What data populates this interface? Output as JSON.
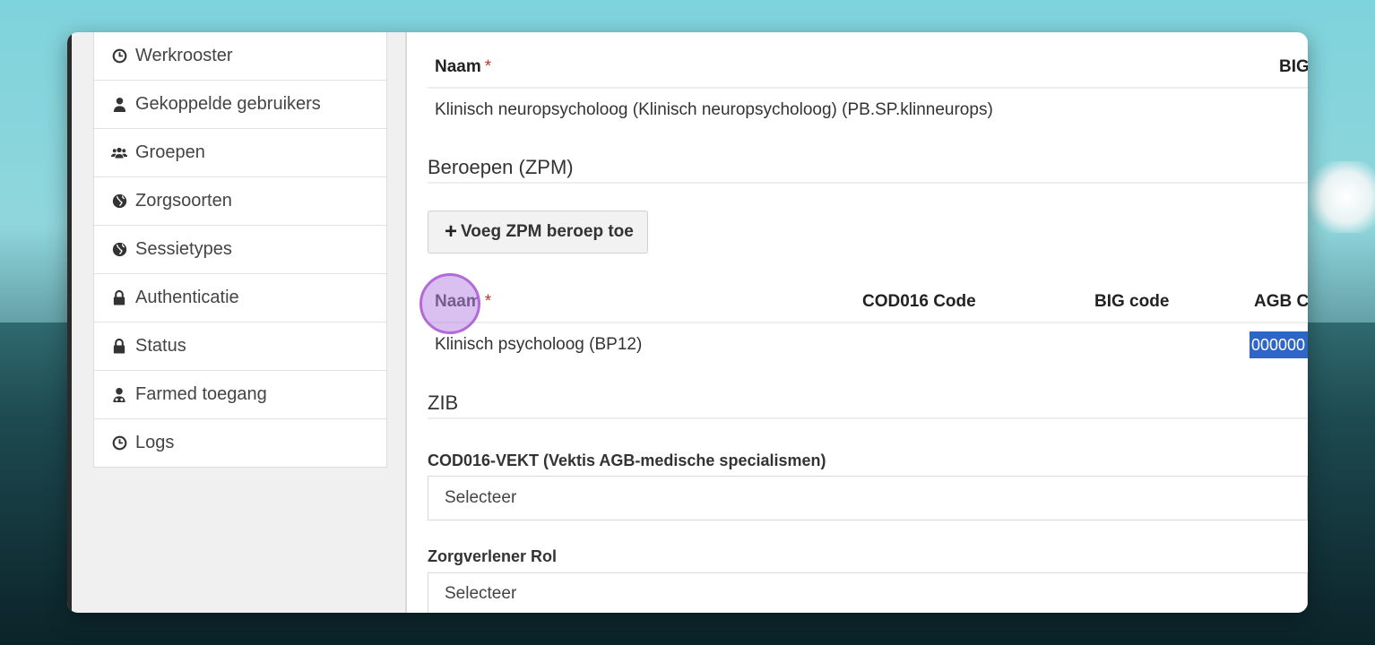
{
  "sidebar": {
    "items": [
      {
        "label": "Werkrooster",
        "icon": "clock-icon"
      },
      {
        "label": "Gekoppelde gebruikers",
        "icon": "user-icon"
      },
      {
        "label": "Groepen",
        "icon": "users-icon"
      },
      {
        "label": "Zorgsoorten",
        "icon": "globe-icon"
      },
      {
        "label": "Sessietypes",
        "icon": "globe-icon"
      },
      {
        "label": "Authenticatie",
        "icon": "lock-icon"
      },
      {
        "label": "Status",
        "icon": "lock-icon"
      },
      {
        "label": "Farmed toegang",
        "icon": "user-md-icon"
      },
      {
        "label": "Logs",
        "icon": "clock-icon"
      }
    ]
  },
  "top_table": {
    "headers": {
      "naam": "Naam",
      "required": "*",
      "big": "BIG"
    },
    "row": "Klinisch neuropsycholoog (Klinisch neuropsycholoog) (PB.SP.klinneurops)"
  },
  "beroepen": {
    "title": "Beroepen (ZPM)",
    "add_button": "Voeg ZPM beroep toe",
    "headers": {
      "naam": "Naam",
      "required": "*",
      "cod016": "COD016 Code",
      "big": "BIG code",
      "agb": "AGB Co"
    },
    "row": {
      "naam": "Klinisch psycholoog (BP12)",
      "agb": "000000"
    }
  },
  "zib": {
    "title": "ZIB",
    "cod016_label": "COD016-VEKT (Vektis AGB-medische specialismen)",
    "cod016_value": "Selecteer",
    "rol_label": "Zorgverlener Rol",
    "rol_value": "Selecteer"
  }
}
